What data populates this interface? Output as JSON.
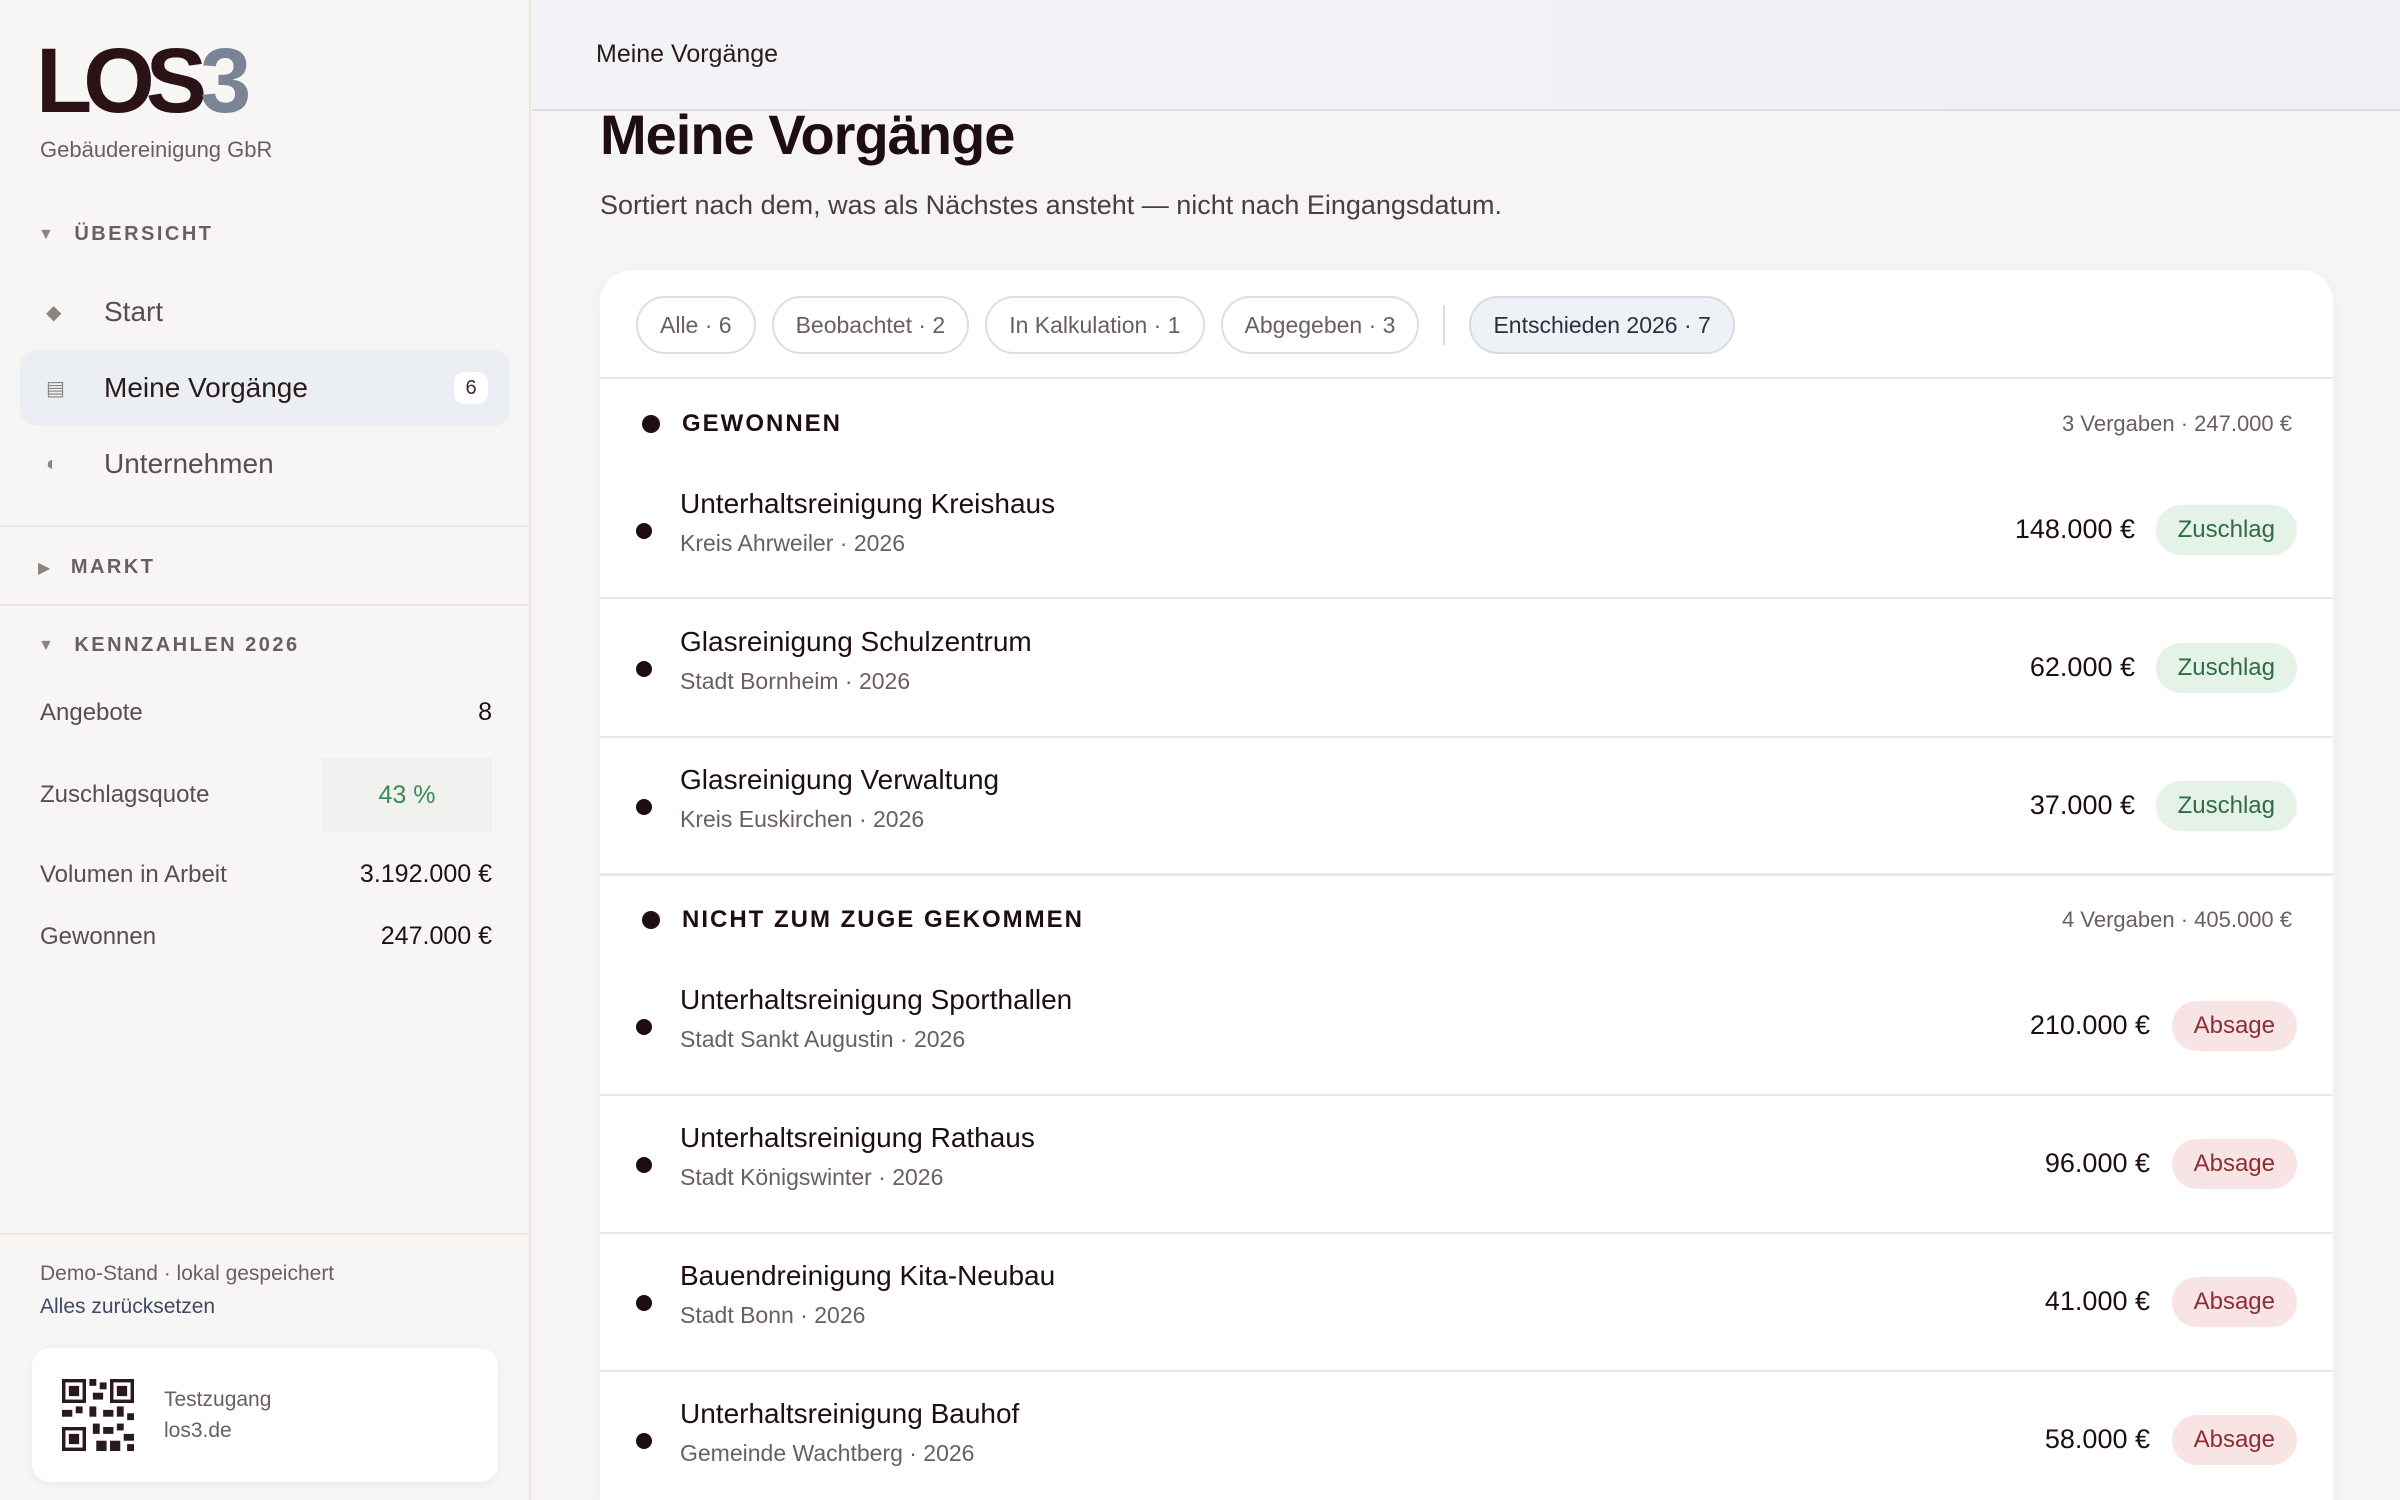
{
  "sidebar": {
    "logo_main": "LOS",
    "logo_accent": "3",
    "subtitle": "Gebäudereinigung GbR",
    "overview_label": "ÜBERSICHT",
    "items": [
      {
        "label": "Start",
        "icon": "diamond-icon"
      },
      {
        "label": "Meine Vorgänge",
        "icon": "list-icon",
        "badge": "6"
      },
      {
        "label": "Unternehmen",
        "icon": "half-circle-icon"
      }
    ],
    "market_label": "MARKT",
    "kpi_label": "KENNZAHLEN 2026",
    "kpis": [
      {
        "label": "Angebote",
        "value": "8"
      },
      {
        "label": "Zuschlagsquote",
        "value": "43 %"
      },
      {
        "label": "Volumen in Arbeit",
        "value": "3.192.000 €"
      },
      {
        "label": "Gewonnen",
        "value": "247.000 €"
      }
    ],
    "footer_note": "Demo-Stand · lokal gespeichert",
    "reset_link": "Alles zurücksetzen",
    "qr_line1": "Testzugang",
    "qr_line2": "los3.de"
  },
  "topbar": {
    "breadcrumb": "Meine Vorgänge"
  },
  "main": {
    "title": "Meine Vorgänge",
    "subtitle": "Sortiert nach dem, was als Nächstes ansteht — nicht nach Eingangsdatum.",
    "filters": [
      "Alle · 6",
      "Beobachtet · 2",
      "In Kalkulation · 1",
      "Abgegeben · 3",
      "Entschieden 2026 · 7"
    ],
    "groups": [
      {
        "title": "GEWONNEN",
        "meta": "3 Vergaben · 247.000 €",
        "rows": [
          {
            "title": "Unterhaltsreinigung Kreishaus",
            "sub": "Kreis Ahrweiler · 2026",
            "amount": "148.000 €",
            "status": "Zuschlag"
          },
          {
            "title": "Glasreinigung Schulzentrum",
            "sub": "Stadt Bornheim · 2026",
            "amount": "62.000 €",
            "status": "Zuschlag"
          },
          {
            "title": "Glasreinigung Verwaltung",
            "sub": "Kreis Euskirchen · 2026",
            "amount": "37.000 €",
            "status": "Zuschlag"
          }
        ]
      },
      {
        "title": "NICHT ZUM ZUGE GEKOMMEN",
        "meta": "4 Vergaben · 405.000 €",
        "rows": [
          {
            "title": "Unterhaltsreinigung Sporthallen",
            "sub": "Stadt Sankt Augustin · 2026",
            "amount": "210.000 €",
            "status": "Absage"
          },
          {
            "title": "Unterhaltsreinigung Rathaus",
            "sub": "Stadt Königswinter · 2026",
            "amount": "96.000 €",
            "status": "Absage"
          },
          {
            "title": "Bauendreinigung Kita-Neubau",
            "sub": "Stadt Bonn · 2026",
            "amount": "41.000 €",
            "status": "Absage"
          },
          {
            "title": "Unterhaltsreinigung Bauhof",
            "sub": "Gemeinde Wachtberg · 2026",
            "amount": "58.000 €",
            "status": "Absage"
          }
        ]
      }
    ]
  },
  "colors": {
    "win": "#2f6b44",
    "loss": "#8b2f34",
    "accent": "#7b8497",
    "brand": "#2a1216"
  }
}
